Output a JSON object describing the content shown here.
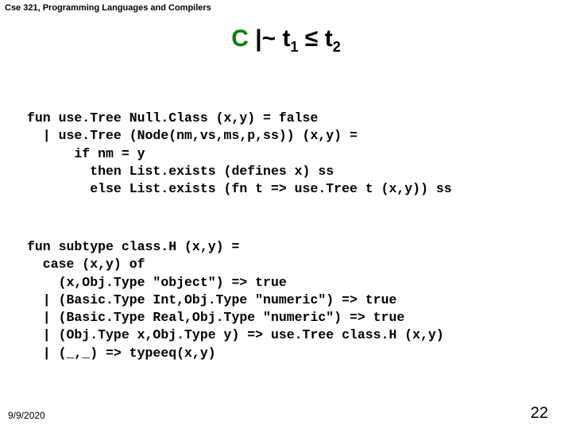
{
  "course_header": "Cse 321, Programming Languages and Compilers",
  "title": {
    "c": "C",
    "sep": " |~ ",
    "t1": "t",
    "sub1": "1",
    "leq": " ≤ ",
    "t2": "t",
    "sub2": "2"
  },
  "code": {
    "block1": "fun use.Tree Null.Class (x,y) = false\n  | use.Tree (Node(nm,vs,ms,p,ss)) (x,y) =\n      if nm = y\n        then List.exists (defines x) ss\n        else List.exists (fn t => use.Tree t (x,y)) ss",
    "block2": "fun subtype class.H (x,y) =\n  case (x,y) of\n    (x,Obj.Type \"object\") => true\n  | (Basic.Type Int,Obj.Type \"numeric\") => true\n  | (Basic.Type Real,Obj.Type \"numeric\") => true\n  | (Obj.Type x,Obj.Type y) => use.Tree class.H (x,y)\n  | (_,_) => typeeq(x,y)"
  },
  "footer": {
    "date": "9/9/2020",
    "pagenum": "22"
  }
}
